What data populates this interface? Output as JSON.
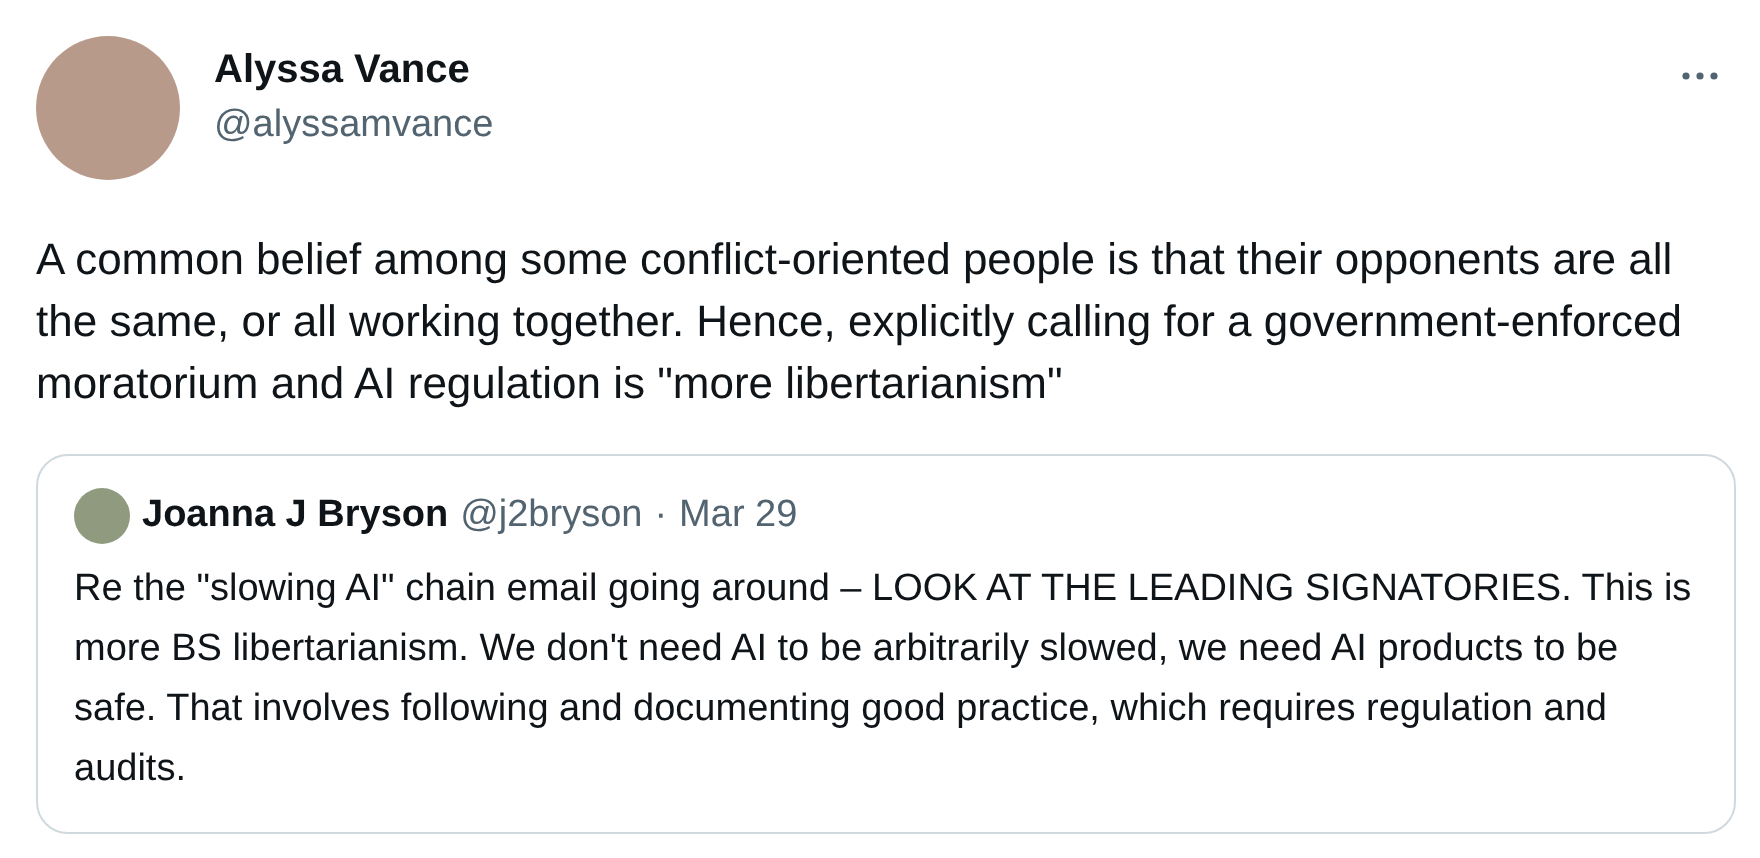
{
  "tweet": {
    "author": {
      "name": "Alyssa Vance",
      "handle": "@alyssamvance"
    },
    "text": "A common belief among some conflict-oriented people is that their opponents are all the same, or all working together. Hence, explicitly calling for a government-enforced moratorium and AI regulation is \"more libertarianism\"",
    "quoted": {
      "author": {
        "name": "Joanna J Bryson",
        "handle": "@j2bryson"
      },
      "separator": "·",
      "date": "Mar 29",
      "text": "Re the \"slowing AI\" chain email going around – LOOK AT THE LEADING SIGNATORIES. This is more BS libertarianism. We don't need AI to be arbitrarily slowed, we need AI products to be safe. That involves following and documenting good practice, which requires regulation and audits."
    }
  }
}
